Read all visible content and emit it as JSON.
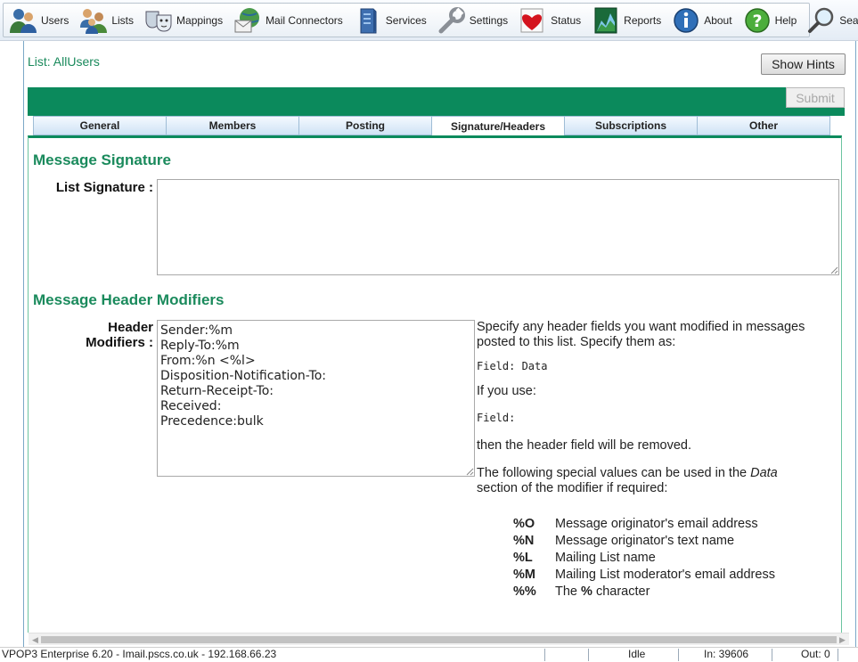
{
  "toolbar": {
    "items": [
      {
        "label": "Users",
        "icon": "users-icon"
      },
      {
        "label": "Lists",
        "icon": "lists-icon"
      },
      {
        "label": "Mappings",
        "icon": "mappings-icon"
      },
      {
        "label": "Mail Connectors",
        "icon": "mail-connectors-icon"
      },
      {
        "label": "Services",
        "icon": "services-icon"
      },
      {
        "label": "Settings",
        "icon": "settings-icon"
      },
      {
        "label": "Status",
        "icon": "status-icon"
      },
      {
        "label": "Reports",
        "icon": "reports-icon"
      },
      {
        "label": "About",
        "icon": "about-icon"
      },
      {
        "label": "Help",
        "icon": "help-icon"
      },
      {
        "label": "Search",
        "icon": "search-icon"
      }
    ]
  },
  "page": {
    "list_title": "List: AllUsers",
    "show_hints_label": "Show Hints",
    "submit_label": "Submit"
  },
  "tabs": [
    {
      "label": "General",
      "active": false
    },
    {
      "label": "Members",
      "active": false
    },
    {
      "label": "Posting",
      "active": false
    },
    {
      "label": "Signature/Headers",
      "active": true
    },
    {
      "label": "Subscriptions",
      "active": false
    },
    {
      "label": "Other",
      "active": false
    }
  ],
  "signature": {
    "heading": "Message Signature",
    "label": "List Signature :",
    "value": ""
  },
  "headers": {
    "heading": "Message Header Modifiers",
    "label_line1": "Header",
    "label_line2": "Modifiers :",
    "value": "Sender:%m\nReply-To:%m\nFrom:%n <%l>\nDisposition-Notification-To:\nReturn-Receipt-To:\nReceived:\nPrecedence:bulk"
  },
  "help": {
    "intro": "Specify any header fields you want modified in messages posted to this list. Specify them as:",
    "example1": "Field: Data",
    "if_you_use": "If you use:",
    "example2": "Field:",
    "removed": "then the header field will be removed.",
    "special_pre": "The following special values can be used in the ",
    "special_italic": "Data",
    "special_post": " section of the modifier if required:",
    "codes": [
      {
        "code": "%O",
        "desc": "Message originator's email address"
      },
      {
        "code": "%N",
        "desc": "Message originator's text name"
      },
      {
        "code": "%L",
        "desc": "Mailing List name"
      },
      {
        "code": "%M",
        "desc": "Mailing List moderator's email address"
      },
      {
        "code": "%%",
        "desc_pre": "The ",
        "desc_bold": "%",
        "desc_post": " character"
      }
    ]
  },
  "statusbar": {
    "app": "VPOP3 Enterprise 6.20 - Imail.pscs.co.uk - 192.168.66.23",
    "state": "Idle",
    "in": "In: 39606",
    "out": "Out: 0"
  },
  "colors": {
    "accent_green": "#0b8a5c",
    "heading_green": "#1a8a5c"
  }
}
